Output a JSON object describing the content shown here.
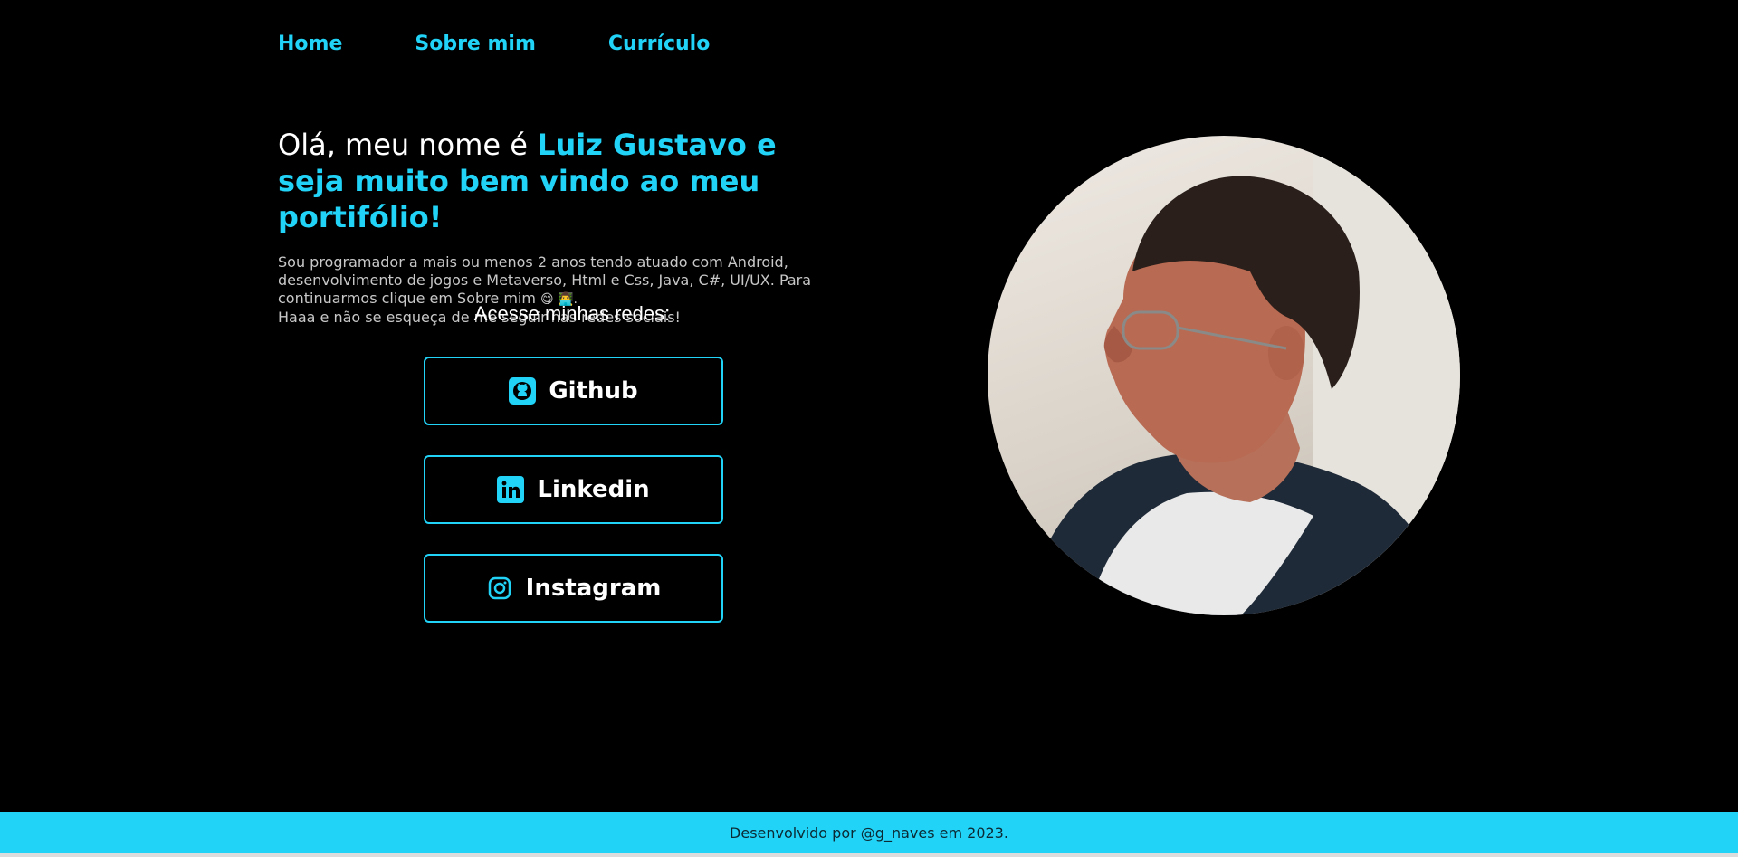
{
  "nav": {
    "home": "Home",
    "about": "Sobre mim",
    "resume": "Currículo"
  },
  "hero": {
    "intro": "Olá, meu nome é ",
    "highlight": "Luiz Gustavo e seja muito bem vindo ao meu portifólio!",
    "bio_line1": "Sou programador a mais ou menos 2 anos tendo atuado com Android,",
    "bio_line2": "desenvolvimento de jogos e Metaverso, Html e Css, Java, C#, UI/UX. Para",
    "bio_line3": "continuarmos clique em Sobre mim",
    "bio_line3_emojis": "😋 👨‍💻.",
    "bio_line4": "Haaa e não se esqueça de me seguir nas redes sociais!"
  },
  "socials": {
    "title": "Acesse minhas redes:",
    "github": "Github",
    "linkedin": "Linkedin",
    "instagram": "Instagram"
  },
  "footer": {
    "text": "Desenvolvido por @g_naves em 2023."
  },
  "colors": {
    "accent": "#22d3f8",
    "background": "#000000",
    "footer_bg": "#22d3f8"
  },
  "icons": {
    "github": "github-icon",
    "linkedin": "linkedin-icon",
    "instagram": "instagram-icon"
  }
}
